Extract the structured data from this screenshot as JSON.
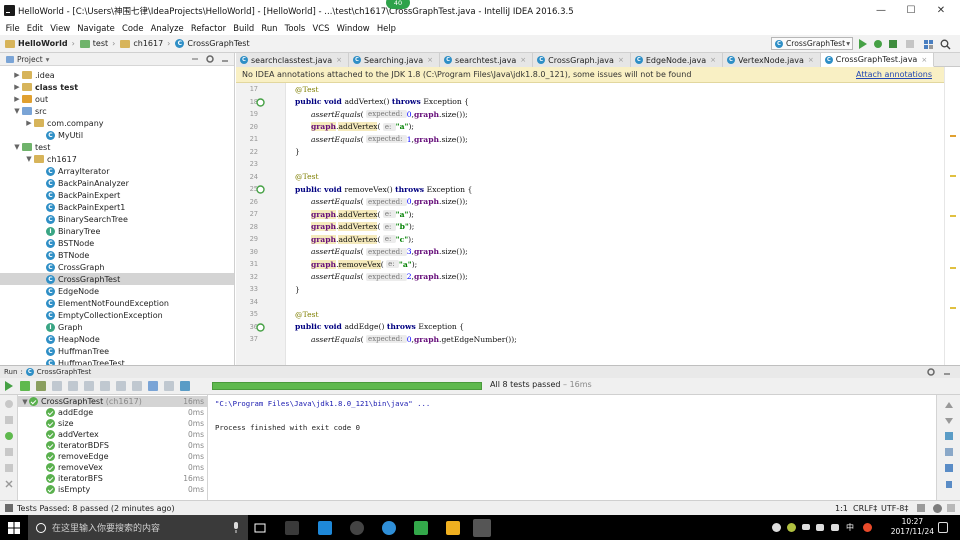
{
  "window": {
    "title": "HelloWorld - [C:\\Users\\神围七律\\IdeaProjects\\HelloWorld] - [HelloWorld] - ...\\test\\ch1617\\CrossGraphTest.java - IntelliJ IDEA 2016.3.5",
    "badge": "40",
    "min": "—",
    "max": "☐",
    "close": "✕"
  },
  "menu": [
    "File",
    "Edit",
    "View",
    "Navigate",
    "Code",
    "Analyze",
    "Refactor",
    "Build",
    "Run",
    "Tools",
    "VCS",
    "Window",
    "Help"
  ],
  "nav": {
    "crumbs": [
      "HelloWorld",
      "test",
      "ch1617",
      "CrossGraphTest"
    ],
    "run_config": "CrossGraphTest"
  },
  "project": {
    "header": "Project",
    "tree": [
      {
        "label": ".idea",
        "indent": 1,
        "arrow": "▶",
        "icon": "folder"
      },
      {
        "label": "class test",
        "indent": 1,
        "arrow": "▶",
        "icon": "folder",
        "bold": true
      },
      {
        "label": "out",
        "indent": 1,
        "arrow": "▶",
        "icon": "folder-orange"
      },
      {
        "label": "src",
        "indent": 1,
        "arrow": "▼",
        "icon": "folder-blue"
      },
      {
        "label": "com.company",
        "indent": 2,
        "arrow": "▶",
        "icon": "folder"
      },
      {
        "label": "MyUtil",
        "indent": 3,
        "arrow": "",
        "icon": "class"
      },
      {
        "label": "test",
        "indent": 1,
        "arrow": "▼",
        "icon": "folder-green"
      },
      {
        "label": "ch1617",
        "indent": 2,
        "arrow": "▼",
        "icon": "folder"
      },
      {
        "label": "ArrayIterator",
        "indent": 3,
        "arrow": "",
        "icon": "class"
      },
      {
        "label": "BackPainAnalyzer",
        "indent": 3,
        "arrow": "",
        "icon": "class"
      },
      {
        "label": "BackPainExpert",
        "indent": 3,
        "arrow": "",
        "icon": "class"
      },
      {
        "label": "BackPainExpert1",
        "indent": 3,
        "arrow": "",
        "icon": "class"
      },
      {
        "label": "BinarySearchTree",
        "indent": 3,
        "arrow": "",
        "icon": "class"
      },
      {
        "label": "BinaryTree",
        "indent": 3,
        "arrow": "",
        "icon": "interface"
      },
      {
        "label": "BSTNode",
        "indent": 3,
        "arrow": "",
        "icon": "class"
      },
      {
        "label": "BTNode",
        "indent": 3,
        "arrow": "",
        "icon": "class"
      },
      {
        "label": "CrossGraph",
        "indent": 3,
        "arrow": "",
        "icon": "class"
      },
      {
        "label": "CrossGraphTest",
        "indent": 3,
        "arrow": "",
        "icon": "class",
        "selected": true
      },
      {
        "label": "EdgeNode",
        "indent": 3,
        "arrow": "",
        "icon": "class"
      },
      {
        "label": "ElementNotFoundException",
        "indent": 3,
        "arrow": "",
        "icon": "class"
      },
      {
        "label": "EmptyCollectionException",
        "indent": 3,
        "arrow": "",
        "icon": "class"
      },
      {
        "label": "Graph",
        "indent": 3,
        "arrow": "",
        "icon": "interface"
      },
      {
        "label": "HeapNode",
        "indent": 3,
        "arrow": "",
        "icon": "class"
      },
      {
        "label": "HuffmanTree",
        "indent": 3,
        "arrow": "",
        "icon": "class"
      },
      {
        "label": "HuffmanTreeTest",
        "indent": 3,
        "arrow": "",
        "icon": "class"
      }
    ]
  },
  "tabs": [
    {
      "label": "searchclasstest.java",
      "active": false
    },
    {
      "label": "Searching.java",
      "active": false
    },
    {
      "label": "searchtest.java",
      "active": false
    },
    {
      "label": "CrossGraph.java",
      "active": false
    },
    {
      "label": "EdgeNode.java",
      "active": false
    },
    {
      "label": "VertexNode.java",
      "active": false
    },
    {
      "label": "CrossGraphTest.java",
      "active": true
    }
  ],
  "banner": {
    "message": "No IDEA annotations attached to the JDK 1.8 (C:\\Program Files\\Java\\jdk1.8.0_121), some issues will not be found",
    "link": "Attach annotations"
  },
  "editor": {
    "line_numbers": [
      "17",
      "18",
      "19",
      "20",
      "21",
      "22",
      "23",
      "24",
      "25",
      "26",
      "27",
      "28",
      "29",
      "30",
      "31",
      "32",
      "33",
      "34",
      "35",
      "36",
      "37"
    ]
  },
  "run": {
    "header": "Run",
    "config": "CrossGraphTest",
    "status": "All 8 tests passed",
    "duration": "– 16ms",
    "suite": {
      "label": "CrossGraphTest",
      "pkg": "(ch1617)",
      "time": "16ms"
    },
    "tests": [
      {
        "name": "addEdge",
        "time": "0ms"
      },
      {
        "name": "size",
        "time": "0ms"
      },
      {
        "name": "addVertex",
        "time": "0ms"
      },
      {
        "name": "iteratorBDFS",
        "time": "0ms"
      },
      {
        "name": "removeEdge",
        "time": "0ms"
      },
      {
        "name": "removeVex",
        "time": "0ms"
      },
      {
        "name": "iteratorBFS",
        "time": "16ms"
      },
      {
        "name": "isEmpty",
        "time": "0ms"
      }
    ],
    "console": [
      "\"C:\\Program Files\\Java\\jdk1.8.0_121\\bin\\java\" ...",
      "Process finished with exit code 0"
    ]
  },
  "status": {
    "left": "Tests Passed: 8 passed (2 minutes ago)",
    "pos": "1:1",
    "crlf": "CRLF‡",
    "enc": "UTF-8‡"
  },
  "taskbar": {
    "search_placeholder": "在这里输入你要搜索的内容",
    "time": "10:27",
    "date": "2017/11/24",
    "ime": "中"
  },
  "colors": {
    "pass_green": "#5ab04e",
    "banner_bg": "#f9f0c4",
    "keyword": "#000080",
    "string": "#008000",
    "field": "#660e7a"
  }
}
